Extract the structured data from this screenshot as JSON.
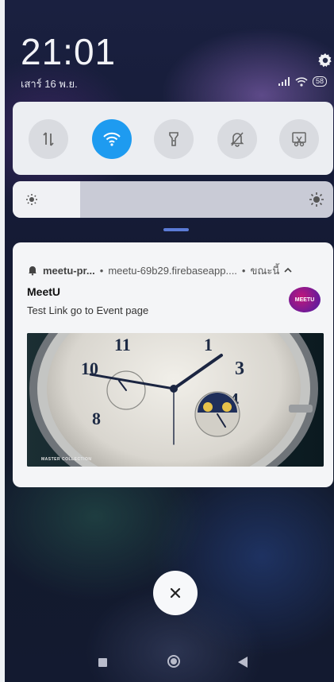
{
  "status": {
    "time": "21:01",
    "date": "เสาร์ 16 พ.ย.",
    "battery": "58",
    "icons": [
      "settings-icon",
      "signal-icon",
      "wifi-icon",
      "battery-icon"
    ]
  },
  "quick_toggles": [
    {
      "name": "mobile-data-toggle",
      "icon": "data-arrows-icon",
      "active": false
    },
    {
      "name": "wifi-toggle",
      "icon": "wifi-icon",
      "active": true
    },
    {
      "name": "flashlight-toggle",
      "icon": "flashlight-icon",
      "active": false
    },
    {
      "name": "silent-toggle",
      "icon": "bell-off-icon",
      "active": false
    },
    {
      "name": "screenshot-toggle",
      "icon": "scissors-icon",
      "active": false
    }
  ],
  "brightness": {
    "level": 0.21
  },
  "notification": {
    "app_name": "meetu-pr...",
    "separator": "•",
    "source": "meetu-69b29.firebaseapp....",
    "time_sep": "•",
    "time": "ขณะนี้",
    "title": "MeetU",
    "body": "Test Link go to Event page",
    "logo_text": "MEETU",
    "image_caption": "MASTER COLLECTION"
  },
  "colors": {
    "accent": "#1e9bf0",
    "panel": "#eceef2",
    "card": "#f4f5f7"
  }
}
